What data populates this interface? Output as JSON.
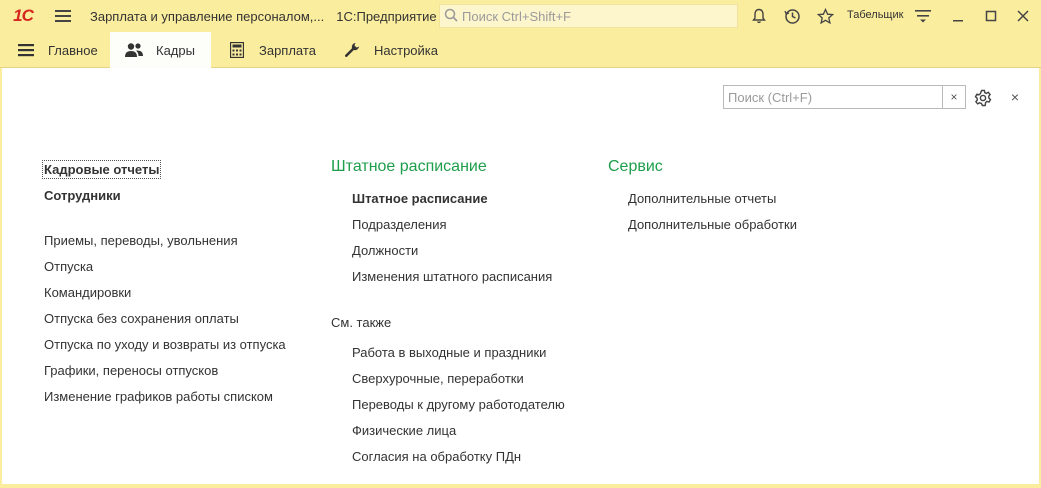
{
  "titlebar": {
    "logo": "1С",
    "window_title": "Зарплата и управление персоналом,...",
    "app_name": "1С:Предприятие",
    "search_placeholder": "Поиск Ctrl+Shift+F",
    "user": "Табельщик"
  },
  "sections": [
    {
      "label": "Главное",
      "icon": "menu-icon"
    },
    {
      "label": "Кадры",
      "icon": "people-icon"
    },
    {
      "label": "Зарплата",
      "icon": "calculator-icon"
    },
    {
      "label": "Настройка",
      "icon": "wrench-icon"
    }
  ],
  "panel": {
    "search_placeholder": "Поиск (Ctrl+F)",
    "clear": "×",
    "close": "×"
  },
  "column1": {
    "items": [
      "Кадровые отчеты",
      "Сотрудники",
      "Приемы, переводы, увольнения",
      "Отпуска",
      "Командировки",
      "Отпуска без сохранения оплаты",
      "Отпуска по уходу и возвраты из отпуска",
      "Графики, переносы отпусков",
      "Изменение графиков работы списком"
    ]
  },
  "column2": {
    "title": "Штатное расписание",
    "items": [
      "Штатное расписание",
      "Подразделения",
      "Должности",
      "Изменения штатного расписания"
    ],
    "see_also_label": "См. также",
    "see_also": [
      "Работа в выходные и праздники",
      "Сверхурочные, переработки",
      "Переводы к другому работодателю",
      "Физические лица",
      "Согласия на обработку ПДн"
    ]
  },
  "column3": {
    "title": "Сервис",
    "items": [
      "Дополнительные отчеты",
      "Дополнительные обработки"
    ]
  }
}
